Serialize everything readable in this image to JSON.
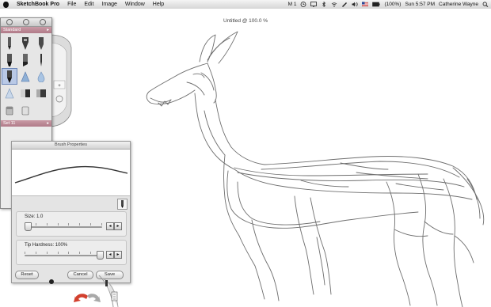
{
  "menubar": {
    "app_name": "SketchBook Pro",
    "menus": [
      "File",
      "Edit",
      "Image",
      "Window",
      "Help"
    ],
    "tray": {
      "m_icon_text": "M 1",
      "battery_text": "(100%)",
      "clock": "Sun 5:57 PM",
      "user": "Catherine Wayne"
    }
  },
  "document": {
    "title": "Untitled @ 100.0 %"
  },
  "brush_palette": {
    "set_name": "Standard",
    "lower_set_name": "Set 11",
    "brushes": [
      "pencil",
      "ballpoint-pen",
      "ink-pen",
      "marker",
      "chisel-marker",
      "felt-pen",
      "airbrush",
      "paintbrush",
      "wet-brush",
      "airbrush-soft",
      "smudge",
      "eraser",
      "triangle-brush",
      "gradient-fill",
      "hard-eraser",
      "bucket",
      "bucket-2",
      "blank"
    ],
    "selected_index": 6
  },
  "brush_properties": {
    "title": "Brush Properties",
    "size_label": "Size: 1.0",
    "size_value": 1.0,
    "size_fraction": 0.0,
    "hardness_label": "Tip Hardness: 100%",
    "hardness_value": 100,
    "hardness_fraction": 1.0,
    "reset_label": "Reset",
    "cancel_label": "Cancel",
    "save_label": "Save"
  },
  "colors": {
    "menubar_bg": "#d6d6d6",
    "set_bar": "#b07a88",
    "selection": "#b9c9e6",
    "undo_red": "#d2402e"
  }
}
